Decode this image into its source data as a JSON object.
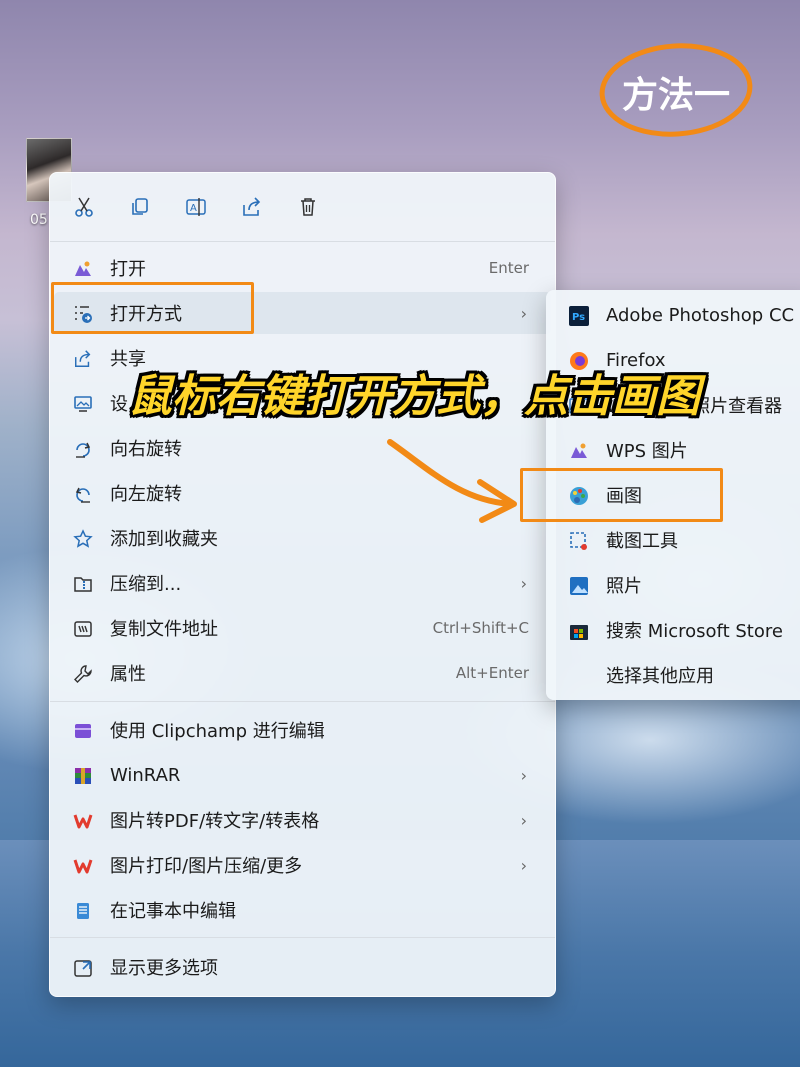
{
  "desktop": {
    "icon_label": "05"
  },
  "badge": {
    "text": "方法一"
  },
  "caption": {
    "text": "鼠标右键打开方式，点击画图"
  },
  "toolbar": {
    "buttons": [
      {
        "name": "cut-icon"
      },
      {
        "name": "copy-icon"
      },
      {
        "name": "rename-icon"
      },
      {
        "name": "share-icon"
      },
      {
        "name": "delete-icon"
      }
    ]
  },
  "menu": {
    "items": [
      {
        "label": "打开",
        "shortcut": "Enter",
        "icon": "photos-app-icon"
      },
      {
        "label": "打开方式",
        "icon": "open-with-icon",
        "submenu": true
      },
      {
        "label": "共享",
        "icon": "share-icon"
      },
      {
        "label": "设",
        "icon": "wallpaper-icon"
      },
      {
        "label": "向右旋转",
        "icon": "rotate-right-icon"
      },
      {
        "label": "向左旋转",
        "icon": "rotate-left-icon"
      },
      {
        "label": "添加到收藏夹",
        "icon": "star-icon"
      },
      {
        "label": "压缩到...",
        "icon": "zip-folder-icon",
        "submenu": true
      },
      {
        "label": "复制文件地址",
        "shortcut": "Ctrl+Shift+C",
        "icon": "copy-path-icon"
      },
      {
        "label": "属性",
        "shortcut": "Alt+Enter",
        "icon": "wrench-icon"
      },
      {
        "label": "使用 Clipchamp 进行编辑",
        "icon": "clipchamp-icon"
      },
      {
        "label": "WinRAR",
        "icon": "winrar-icon",
        "submenu": true
      },
      {
        "label": "图片转PDF/转文字/转表格",
        "icon": "wps-icon",
        "submenu": true
      },
      {
        "label": "图片打印/图片压缩/更多",
        "icon": "wps-icon",
        "submenu": true
      },
      {
        "label": "在记事本中编辑",
        "icon": "notepad-icon"
      },
      {
        "label": "显示更多选项",
        "icon": "show-more-icon"
      }
    ]
  },
  "submenu": {
    "items": [
      {
        "label": "Adobe Photoshop CC .",
        "icon": "photoshop-icon"
      },
      {
        "label": "Firefox",
        "icon": "firefox-icon"
      },
      {
        "label": "Windows 照片查看器",
        "icon": "photo-viewer-icon"
      },
      {
        "label": "WPS 图片",
        "icon": "wps-picture-icon"
      },
      {
        "label": "画图",
        "icon": "paint-icon"
      },
      {
        "label": "截图工具",
        "icon": "snipping-tool-icon"
      },
      {
        "label": "照片",
        "icon": "photos-icon"
      },
      {
        "label": "搜索 Microsoft Store",
        "icon": "store-icon"
      },
      {
        "label": "选择其他应用",
        "icon": ""
      }
    ]
  },
  "colors": {
    "highlight": "#f28a16",
    "caption": "#ffd52a"
  }
}
